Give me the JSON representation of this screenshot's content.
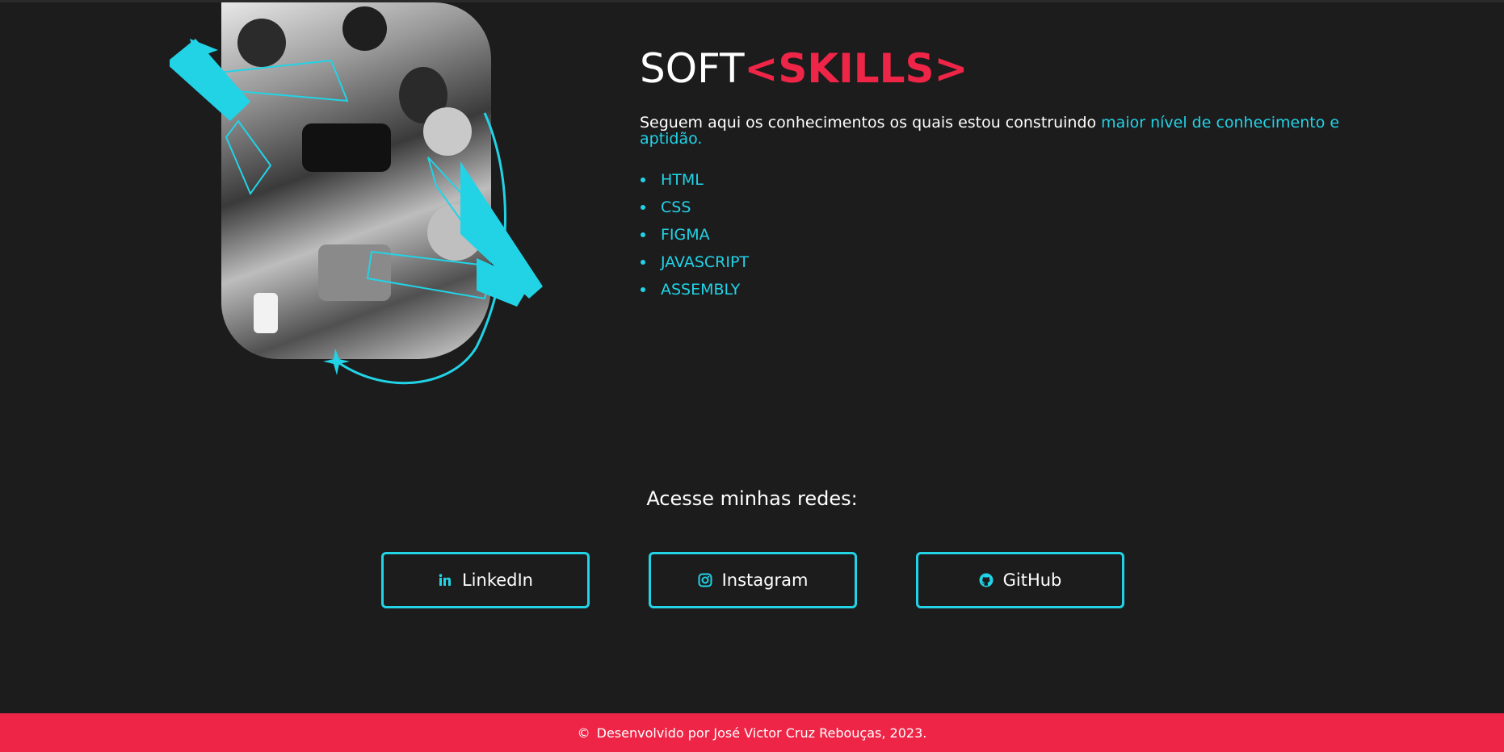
{
  "skills": {
    "title_plain": "SOFT",
    "title_accent": "<SKILLS>",
    "intro_text": "Seguem aqui os conhecimentos os quais estou construindo ",
    "intro_highlight": "maior nível de conhecimento e aptidão.",
    "items": [
      "HTML",
      "CSS",
      "FIGMA",
      "JAVASCRIPT",
      "ASSEMBLY"
    ]
  },
  "networks": {
    "title": "Acesse minhas redes:",
    "buttons": [
      {
        "label": "LinkedIn",
        "icon": "linkedin-icon"
      },
      {
        "label": "Instagram",
        "icon": "instagram-icon"
      },
      {
        "label": "GitHub",
        "icon": "github-icon"
      }
    ]
  },
  "footer": {
    "copyright_symbol": "©",
    "text": "Desenvolvido por José Victor Cruz Rebouças, 2023."
  },
  "colors": {
    "background": "#1c1c1d",
    "accent_cyan": "#22d3e6",
    "accent_red": "#ee2547"
  }
}
